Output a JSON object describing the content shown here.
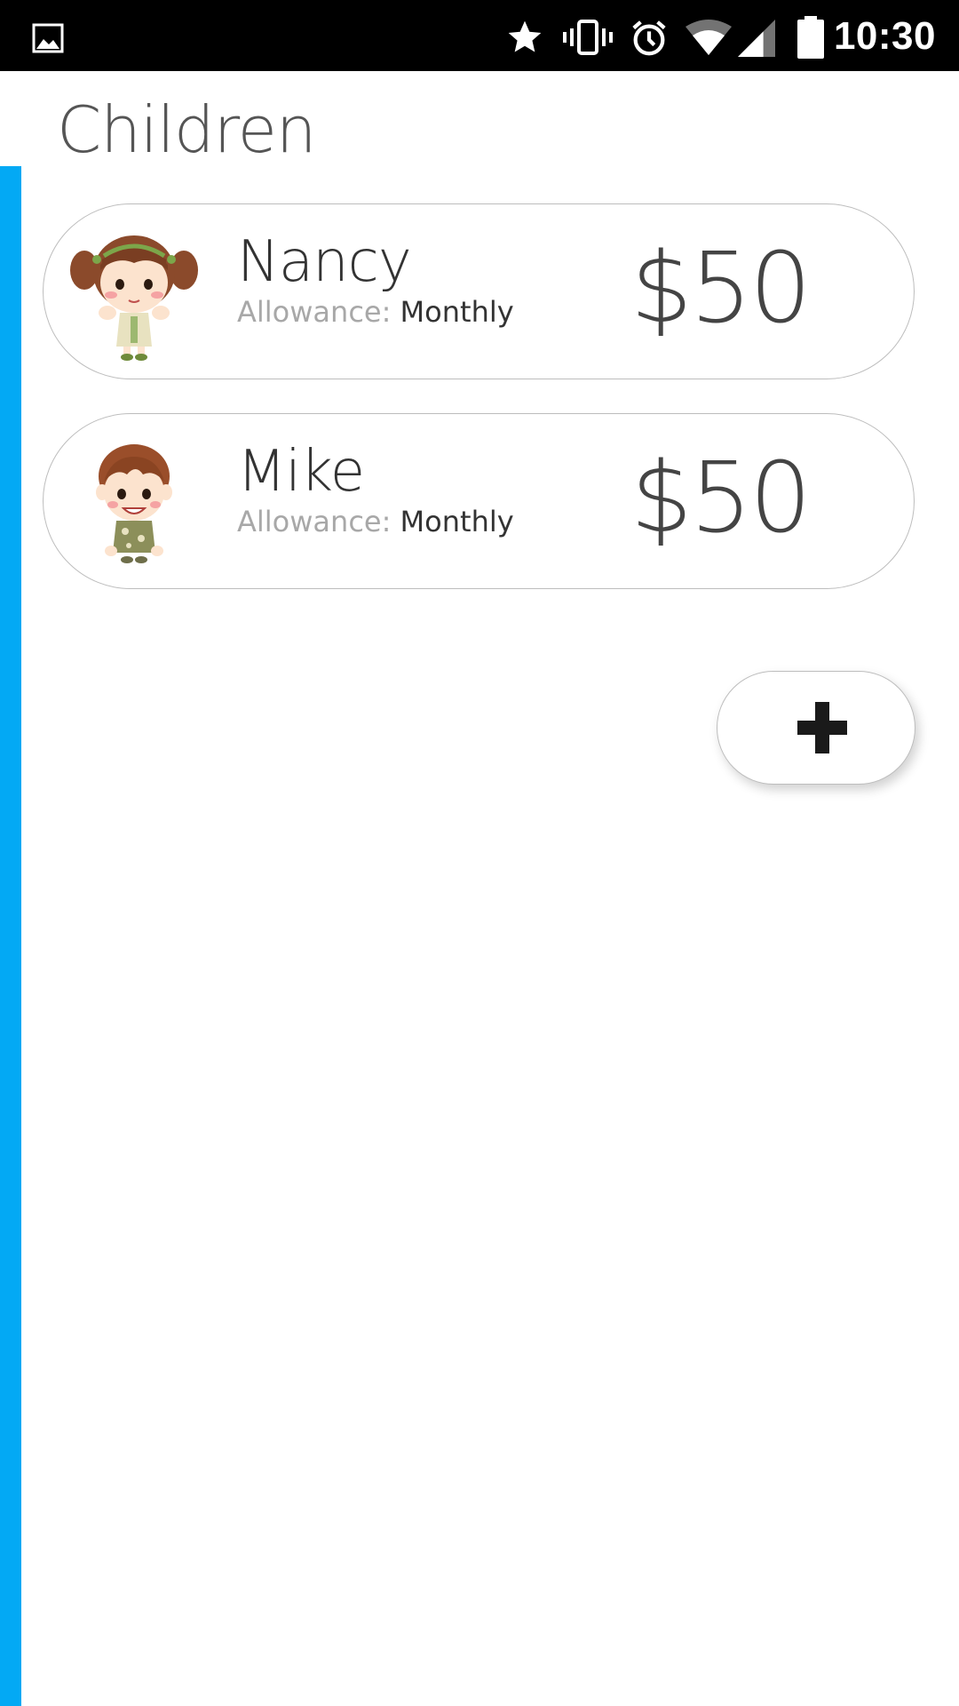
{
  "status_bar": {
    "time": "10:30",
    "left_icon": "image-icon",
    "icons": [
      "star-icon",
      "vibrate-icon",
      "alarm-icon",
      "wifi-icon",
      "signal-icon",
      "battery-icon"
    ]
  },
  "header": {
    "title": "Children"
  },
  "theme": {
    "accent": "#03A9F4"
  },
  "children": [
    {
      "name": "Nancy",
      "allowance_label": "Allowance:",
      "allowance_frequency": "Monthly",
      "amount": "$50",
      "avatar": "girl-avatar"
    },
    {
      "name": "Mike",
      "allowance_label": "Allowance:",
      "allowance_frequency": "Monthly",
      "amount": "$50",
      "avatar": "boy-avatar"
    }
  ],
  "add_button": {
    "icon": "plus-icon"
  }
}
